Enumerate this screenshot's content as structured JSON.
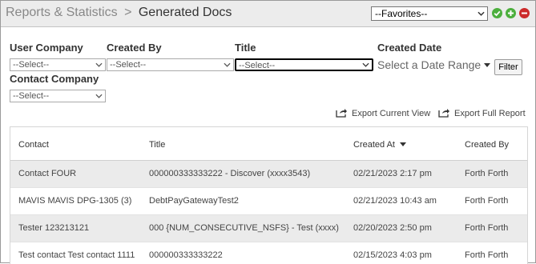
{
  "header": {
    "breadcrumb_root": "Reports & Statistics",
    "breadcrumb_sep": ">",
    "breadcrumb_current": "Generated Docs",
    "favorites_value": "--Favorites--"
  },
  "actions": {
    "confirm_icon": "check-icon",
    "add_icon": "plus-icon",
    "remove_icon": "minus-icon",
    "colors": {
      "confirm": "#4caf3d",
      "add": "#4caf3d",
      "remove": "#cc2a2a"
    }
  },
  "filters": {
    "user_company_label": "User Company",
    "user_company_value": "--Select--",
    "created_by_label": "Created By",
    "created_by_value": "--Select--",
    "title_label": "Title",
    "title_value": "--Select--",
    "created_date_label": "Created Date",
    "created_date_placeholder": "Select a Date Range",
    "contact_company_label": "Contact Company",
    "contact_company_value": "--Select--",
    "filter_button": "Filter"
  },
  "exports": {
    "current_view": "Export Current View",
    "full_report": "Export Full Report"
  },
  "table": {
    "columns": [
      "Contact",
      "Title",
      "Created At",
      "Created By"
    ],
    "sorted_column": "Created At",
    "sort_direction": "descending",
    "rows": [
      {
        "contact": "Contact FOUR",
        "title": "000000333333222 - Discover (xxxx3543)",
        "created_at": "02/21/2023 2:17 pm",
        "created_by": "Forth Forth"
      },
      {
        "contact": "MAVIS MAVIS DPG-1305 (3)",
        "title": "DebtPayGatewayTest2",
        "created_at": "02/21/2023 10:43 am",
        "created_by": "Forth Forth"
      },
      {
        "contact": "Tester 123213121",
        "title": "000 {NUM_CONSECUTIVE_NSFS} - Test (xxxx)",
        "created_at": "02/20/2023 2:50 pm",
        "created_by": "Forth Forth"
      },
      {
        "contact": "Test contact Test contact 1111",
        "title": "000000333333222",
        "created_at": "02/15/2023 4:03 pm",
        "created_by": "Forth Forth"
      }
    ]
  }
}
